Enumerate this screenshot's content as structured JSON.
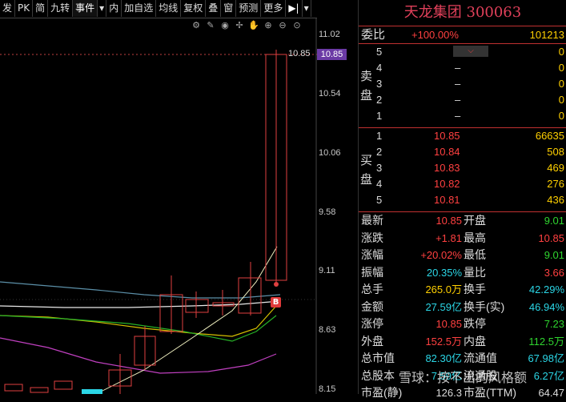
{
  "toolbar": {
    "items": [
      "发",
      "PK",
      "简",
      "九转",
      "事件",
      "▾",
      "内",
      "加自选",
      "均线",
      "复权",
      "叠",
      "窗",
      "预测",
      "更多",
      "▶|",
      "▾"
    ]
  },
  "chart": {
    "y_ticks": [
      "11.02",
      "10.54",
      "10.06",
      "9.58",
      "9.11",
      "8.63",
      "8.15"
    ],
    "current_price_label": "10.85",
    "price_tag": "10.85",
    "b_marker": "B"
  },
  "quote": {
    "title": "天龙集团 300063",
    "weibi_label": "委比",
    "weibi_value": "+100.00%",
    "weicha_value": "101213",
    "sell_label": "卖盘",
    "buy_label": "买盘",
    "sell": [
      {
        "level": "5",
        "price": "",
        "vol": "0"
      },
      {
        "level": "4",
        "price": "–",
        "vol": "0"
      },
      {
        "level": "3",
        "price": "–",
        "vol": "0"
      },
      {
        "level": "2",
        "price": "–",
        "vol": "0"
      },
      {
        "level": "1",
        "price": "–",
        "vol": "0"
      }
    ],
    "buy": [
      {
        "level": "1",
        "price": "10.85",
        "vol": "66635"
      },
      {
        "level": "2",
        "price": "10.84",
        "vol": "508"
      },
      {
        "level": "3",
        "price": "10.83",
        "vol": "469"
      },
      {
        "level": "4",
        "price": "10.82",
        "vol": "276"
      },
      {
        "level": "5",
        "price": "10.81",
        "vol": "436"
      }
    ],
    "stats": [
      {
        "l1": "最新",
        "v1": "10.85",
        "c1": "red",
        "l2": "开盘",
        "v2": "9.01",
        "c2": "grn"
      },
      {
        "l1": "涨跌",
        "v1": "+1.81",
        "c1": "red",
        "l2": "最高",
        "v2": "10.85",
        "c2": "red"
      },
      {
        "l1": "涨幅",
        "v1": "+20.02%",
        "c1": "red",
        "l2": "最低",
        "v2": "9.01",
        "c2": "grn"
      },
      {
        "l1": "振幅",
        "v1": "20.35%",
        "c1": "cyn",
        "l2": "量比",
        "v2": "3.66",
        "c2": "red"
      },
      {
        "l1": "总手",
        "v1": "265.0万",
        "c1": "yel",
        "l2": "换手",
        "v2": "42.29%",
        "c2": "cyn"
      },
      {
        "l1": "金额",
        "v1": "27.59亿",
        "c1": "cyn",
        "l2": "换手(实)",
        "v2": "46.94%",
        "c2": "cyn"
      },
      {
        "l1": "涨停",
        "v1": "10.85",
        "c1": "red",
        "l2": "跌停",
        "v2": "7.23",
        "c2": "grn"
      },
      {
        "l1": "外盘",
        "v1": "152.5万",
        "c1": "red",
        "l2": "内盘",
        "v2": "112.5万",
        "c2": "grn"
      },
      {
        "l1": "总市值",
        "v1": "82.30亿",
        "c1": "cyn",
        "l2": "流通值",
        "v2": "67.98亿",
        "c2": "cyn"
      },
      {
        "l1": "总股本",
        "v1": "7.59亿",
        "c1": "cyn",
        "l2": "流通股",
        "v2": "6.27亿",
        "c2": "cyn"
      },
      {
        "l1": "市盈(静)",
        "v1": "126.3",
        "c1": "wht",
        "l2": "市盈(TTM)",
        "v2": "64.47",
        "c2": "wht"
      }
    ],
    "watermark": "雪球：按不出的风格额"
  }
}
